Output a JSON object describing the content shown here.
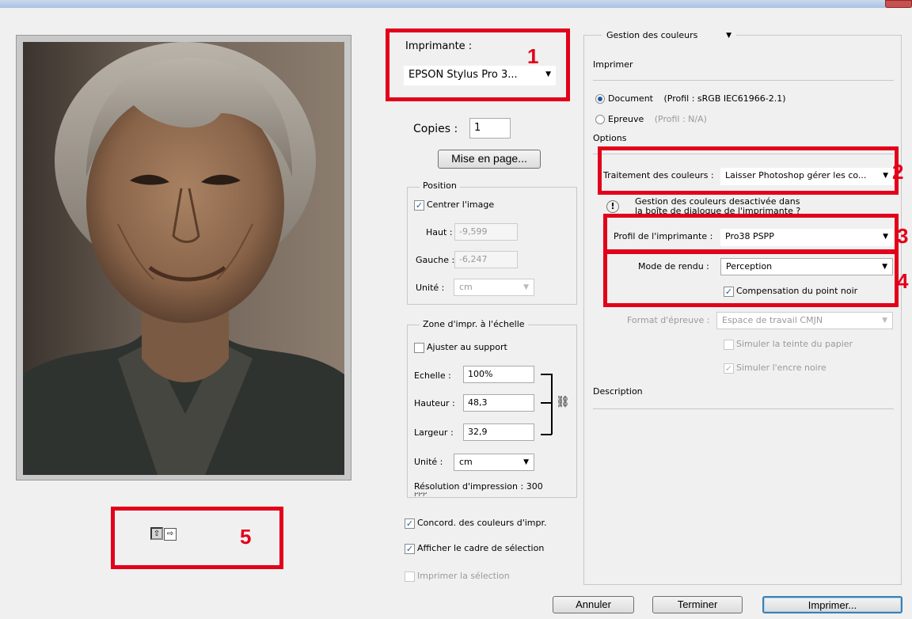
{
  "window": {
    "close_label": "X"
  },
  "printer": {
    "label": "Imprimante :",
    "value": "EPSON Stylus Pro 3..."
  },
  "copies": {
    "label": "Copies :",
    "value": "1"
  },
  "page_setup_button": "Mise en page...",
  "position": {
    "legend": "Position",
    "center_label": "Centrer l'image",
    "center_checked": true,
    "top_label": "Haut :",
    "top_value": "-9,599",
    "left_label": "Gauche :",
    "left_value": "-6,247",
    "unit_label": "Unité :",
    "unit_value": "cm"
  },
  "scale": {
    "legend": "Zone d'impr. à l'échelle",
    "fit_label": "Ajuster au support",
    "fit_checked": false,
    "scale_label": "Echelle :",
    "scale_value": "100%",
    "height_label": "Hauteur :",
    "height_value": "48,3",
    "width_label": "Largeur :",
    "width_value": "32,9",
    "unit_label": "Unité :",
    "unit_value": "cm",
    "resolution_text": "Résolution d'impression : 300",
    "resolution_overflow": "PPP"
  },
  "options": {
    "match_colors_label": "Concord. des couleurs d'impr.",
    "match_colors_checked": true,
    "bounding_box_label": "Afficher le cadre de sélection",
    "bounding_box_checked": true,
    "print_selection_label": "Imprimer la sélection",
    "print_selection_checked": false
  },
  "right_panel": {
    "section_select": "Gestion des couleurs",
    "print_heading": "Imprimer",
    "document_label": "Document",
    "document_profile": "(Profil : sRGB IEC61966-2.1)",
    "document_selected": true,
    "proof_label": "Epreuve",
    "proof_profile": "(Profil : N/A)",
    "options_heading": "Options",
    "color_handling_label": "Traitement des couleurs :",
    "color_handling_value": "Laisser Photoshop gérer les co...",
    "warning_line1": "Gestion des couleurs desactivée dans",
    "warning_line2": "la boîte de dialogue de l'imprimante ?",
    "printer_profile_label": "Profil de l'imprimante :",
    "printer_profile_value": "Pro38 PSPP",
    "render_mode_label": "Mode de rendu :",
    "render_mode_value": "Perception",
    "black_point_label": "Compensation du point noir",
    "black_point_checked": true,
    "proof_format_label": "Format d'épreuve :",
    "proof_format_value": "Espace de travail CMJN",
    "simulate_paper_label": "Simuler la teinte du papier",
    "simulate_ink_label": "Simuler l'encre noire",
    "description_heading": "Description"
  },
  "buttons": {
    "cancel": "Annuler",
    "done": "Terminer",
    "print": "Imprimer..."
  },
  "callouts": [
    "1",
    "2",
    "3",
    "4",
    "5"
  ],
  "colors": {
    "callout_red": "#e2001a",
    "dialog_bg": "#f0f0f0"
  },
  "preview_icons": [
    "portrait-orientation-icon",
    "landscape-orientation-icon"
  ],
  "chain_icon": "link-icon"
}
